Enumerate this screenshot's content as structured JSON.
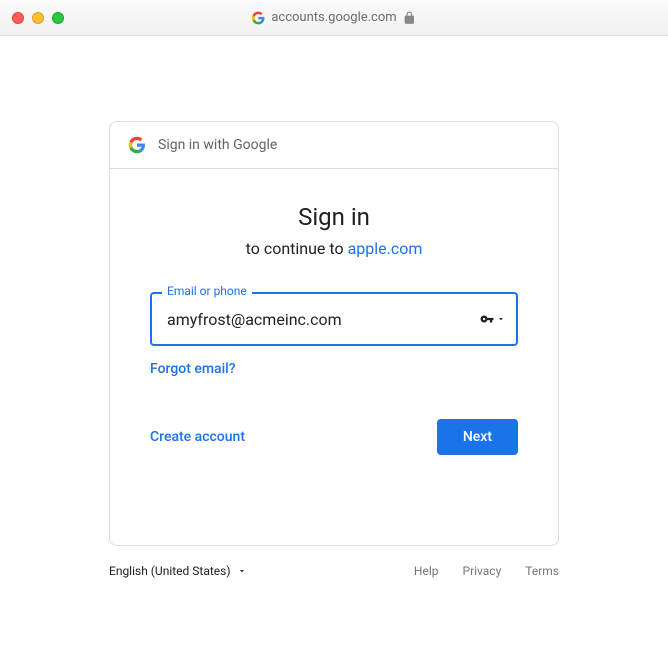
{
  "browser": {
    "url": "accounts.google.com"
  },
  "card": {
    "header_text": "Sign in with Google",
    "title": "Sign in",
    "continue_prefix": "to continue to ",
    "continue_target": "apple.com",
    "email_label": "Email or phone",
    "email_value": "amyfrost@acmeinc.com",
    "forgot_email": "Forgot email?",
    "create_account": "Create account",
    "next": "Next"
  },
  "footer": {
    "language": "English (United States)",
    "help": "Help",
    "privacy": "Privacy",
    "terms": "Terms"
  }
}
